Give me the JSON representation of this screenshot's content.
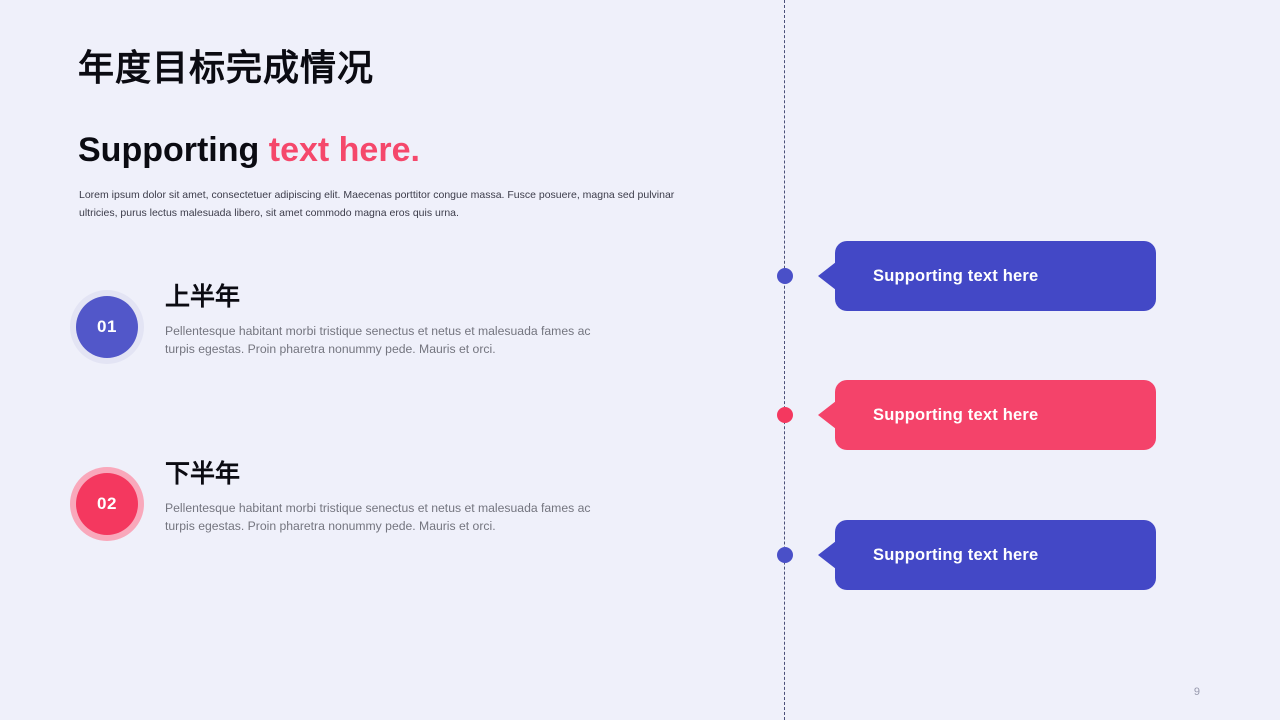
{
  "slide": {
    "background_color": "#eff0fa",
    "page_number": "9"
  },
  "header": {
    "title": "年度目标完成情况",
    "subtitle_plain": "Supporting ",
    "subtitle_accent": "text here.",
    "accent_color": "#f5486b",
    "paragraph": "Lorem ipsum dolor sit amet, consectetuer adipiscing elit. Maecenas porttitor congue massa. Fusce posuere, magna sed pulvinar ultricies, purus lectus malesuada libero, sit amet commodo magna eros quis urna."
  },
  "items": [
    {
      "number": "01",
      "heading": "上半年",
      "text": "Pellentesque habitant morbi tristique senectus et netus et malesuada fames ac turpis egestas. Proin pharetra nonummy pede. Mauris et orci.",
      "color": "#5257c9",
      "ring_color": "#e3e4f4"
    },
    {
      "number": "02",
      "heading": "下半年",
      "text": "Pellentesque habitant morbi tristique senectus et netus et malesuada fames ac turpis egestas. Proin pharetra nonummy pede. Mauris et orci.",
      "color": "#f4385f",
      "ring_color": "#f9a8bb"
    }
  ],
  "timeline": {
    "line_color": "#4a4f78",
    "callouts": [
      {
        "label": "Supporting text here",
        "color": "#4348c6",
        "dot_color": "#4a50c8"
      },
      {
        "label": "Supporting text here",
        "color": "#f4436a",
        "dot_color": "#f4385f"
      },
      {
        "label": "Supporting text here",
        "color": "#4348c6",
        "dot_color": "#4a50c8"
      }
    ]
  }
}
